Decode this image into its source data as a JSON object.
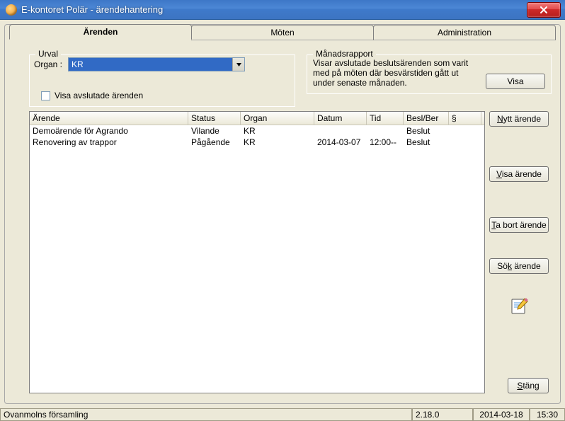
{
  "window": {
    "title": "E-kontoret Polär - ärendehantering"
  },
  "tabs": {
    "arenden": "Ärenden",
    "moten": "Möten",
    "admin": "Administration"
  },
  "urval": {
    "legend": "Urval",
    "organ_label": "Organ :",
    "organ_value": "KR",
    "checkbox_label": "Visa avslutade ärenden"
  },
  "manads": {
    "legend": "Månadsrapport",
    "info": "Visar avslutade beslutsärenden som varit med på möten där besvärstiden gått ut under senaste månaden.",
    "visa_label": "Visa"
  },
  "table": {
    "headers": {
      "arende": "Ärende",
      "status": "Status",
      "organ": "Organ",
      "datum": "Datum",
      "tid": "Tid",
      "beslber": "Besl/Ber",
      "paragraph": "§"
    },
    "rows": [
      {
        "arende": "Demoärende för Agrando",
        "status": "Vilande",
        "organ": "KR",
        "datum": "",
        "tid": "",
        "beslber": "Beslut",
        "paragraph": ""
      },
      {
        "arende": "Renovering av trappor",
        "status": "Pågående",
        "organ": "KR",
        "datum": "2014-03-07",
        "tid": "12:00--",
        "beslber": "Beslut",
        "paragraph": ""
      }
    ]
  },
  "buttons": {
    "nytt": {
      "pre": "",
      "u": "N",
      "post": "ytt ärende"
    },
    "visa": {
      "pre": "",
      "u": "V",
      "post": "isa ärende"
    },
    "tabort": {
      "pre": "",
      "u": "T",
      "post": "a bort ärende"
    },
    "sok": {
      "pre": "Sö",
      "u": "k",
      "post": " ärende"
    },
    "stang": {
      "pre": "",
      "u": "S",
      "post": "täng"
    }
  },
  "status": {
    "org": "Ovanmolns församling",
    "version": "2.18.0",
    "date": "2014-03-18",
    "time": "15:30"
  }
}
